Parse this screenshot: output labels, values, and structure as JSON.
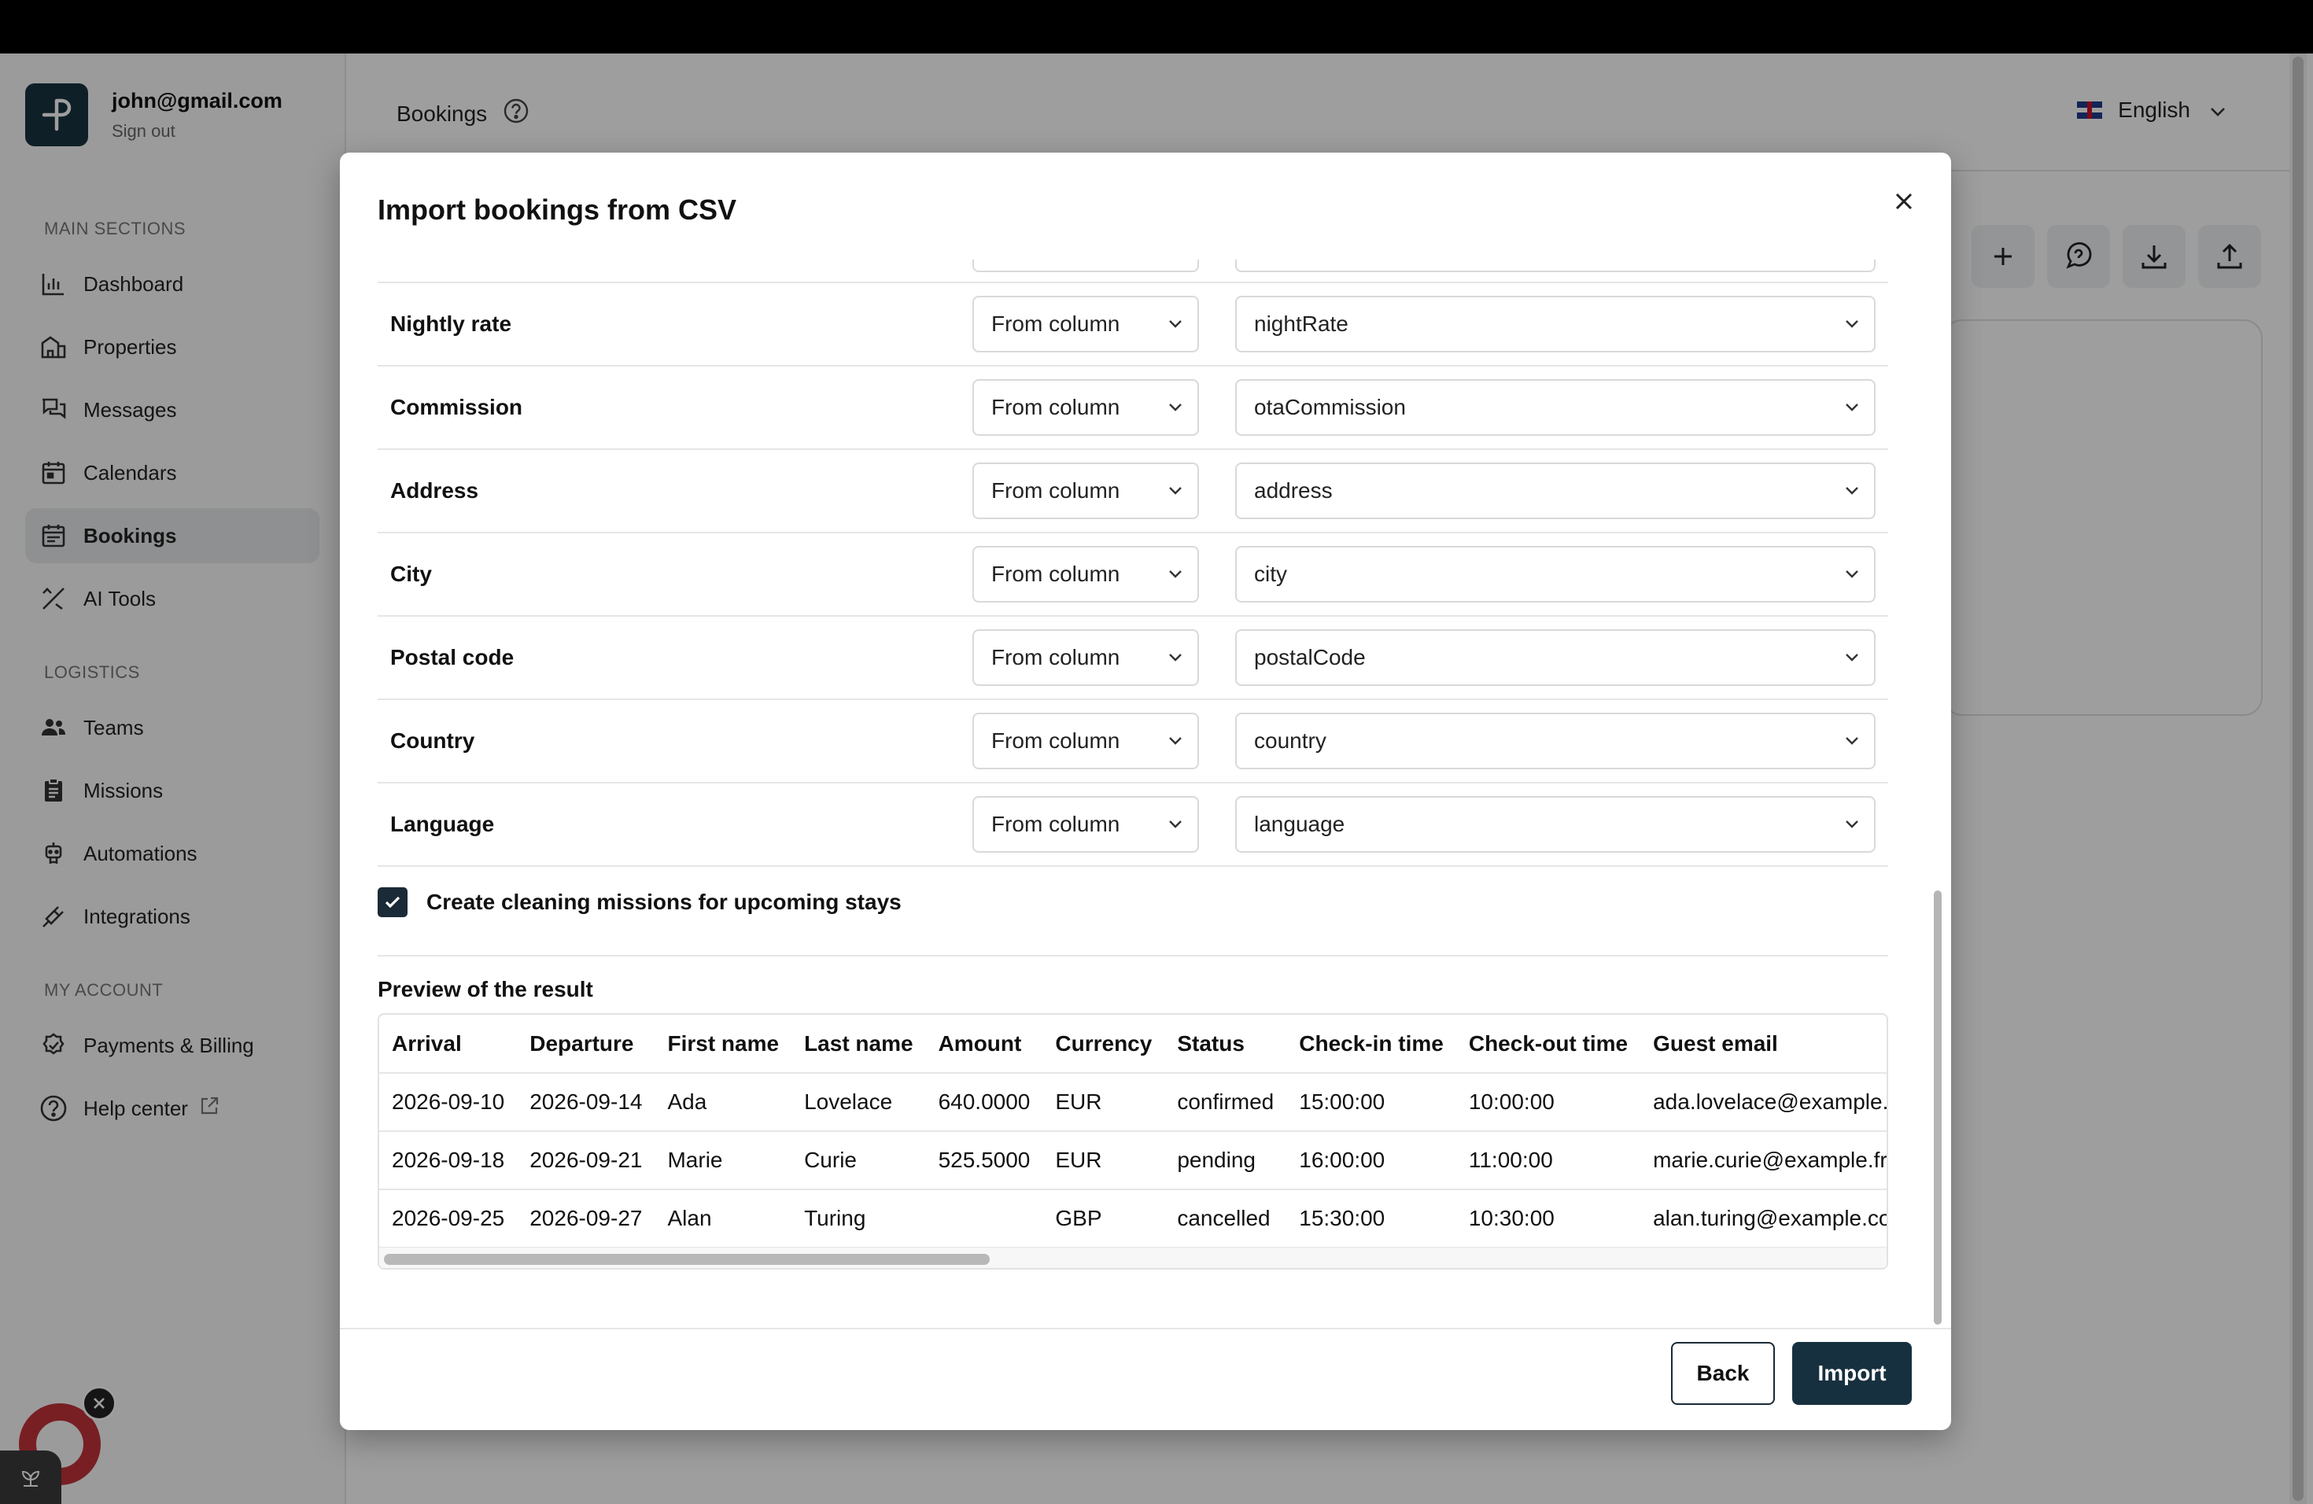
{
  "account": {
    "email": "john@gmail.com",
    "sign_out": "Sign out"
  },
  "sidebar": {
    "sections": [
      {
        "title": "MAIN SECTIONS",
        "items": [
          {
            "label": "Dashboard",
            "icon": "chart-bar-icon"
          },
          {
            "label": "Properties",
            "icon": "building-icon"
          },
          {
            "label": "Messages",
            "icon": "chat-icon"
          },
          {
            "label": "Calendars",
            "icon": "calendar-icon"
          },
          {
            "label": "Bookings",
            "icon": "booking-icon",
            "active": true
          },
          {
            "label": "AI Tools",
            "icon": "tools-icon"
          }
        ]
      },
      {
        "title": "LOGISTICS",
        "items": [
          {
            "label": "Teams",
            "icon": "team-icon"
          },
          {
            "label": "Missions",
            "icon": "clipboard-icon"
          },
          {
            "label": "Automations",
            "icon": "robot-icon"
          },
          {
            "label": "Integrations",
            "icon": "plug-icon"
          }
        ]
      },
      {
        "title": "MY ACCOUNT",
        "items": [
          {
            "label": "Payments & Billing",
            "icon": "billing-icon"
          },
          {
            "label": "Help center",
            "icon": "help-icon",
            "external": true
          }
        ]
      }
    ]
  },
  "header": {
    "title": "Bookings",
    "language": "English"
  },
  "modal": {
    "title": "Import bookings from CSV",
    "mappings": [
      {
        "field": "Nightly rate",
        "source": "From column",
        "column": "nightRate"
      },
      {
        "field": "Commission",
        "source": "From column",
        "column": "otaCommission"
      },
      {
        "field": "Address",
        "source": "From column",
        "column": "address"
      },
      {
        "field": "City",
        "source": "From column",
        "column": "city"
      },
      {
        "field": "Postal code",
        "source": "From column",
        "column": "postalCode"
      },
      {
        "field": "Country",
        "source": "From column",
        "column": "country"
      },
      {
        "field": "Language",
        "source": "From column",
        "column": "language"
      }
    ],
    "checkbox": {
      "label": "Create cleaning missions for upcoming stays",
      "checked": true
    },
    "preview": {
      "title": "Preview of the result",
      "columns": [
        "Arrival",
        "Departure",
        "First name",
        "Last name",
        "Amount",
        "Currency",
        "Status",
        "Check-in time",
        "Check-out time",
        "Guest email"
      ],
      "rows": [
        [
          "2026-09-10",
          "2026-09-14",
          "Ada",
          "Lovelace",
          "640.0000",
          "EUR",
          "confirmed",
          "15:00:00",
          "10:00:00",
          "ada.lovelace@example.com"
        ],
        [
          "2026-09-18",
          "2026-09-21",
          "Marie",
          "Curie",
          "525.5000",
          "EUR",
          "pending",
          "16:00:00",
          "11:00:00",
          "marie.curie@example.fr"
        ],
        [
          "2026-09-25",
          "2026-09-27",
          "Alan",
          "Turing",
          "",
          "GBP",
          "cancelled",
          "15:30:00",
          "10:30:00",
          "alan.turing@example.co.uk"
        ]
      ]
    },
    "buttons": {
      "back": "Back",
      "import": "Import"
    }
  },
  "colors": {
    "primary": "#17303f",
    "widget": "#c2323a"
  }
}
